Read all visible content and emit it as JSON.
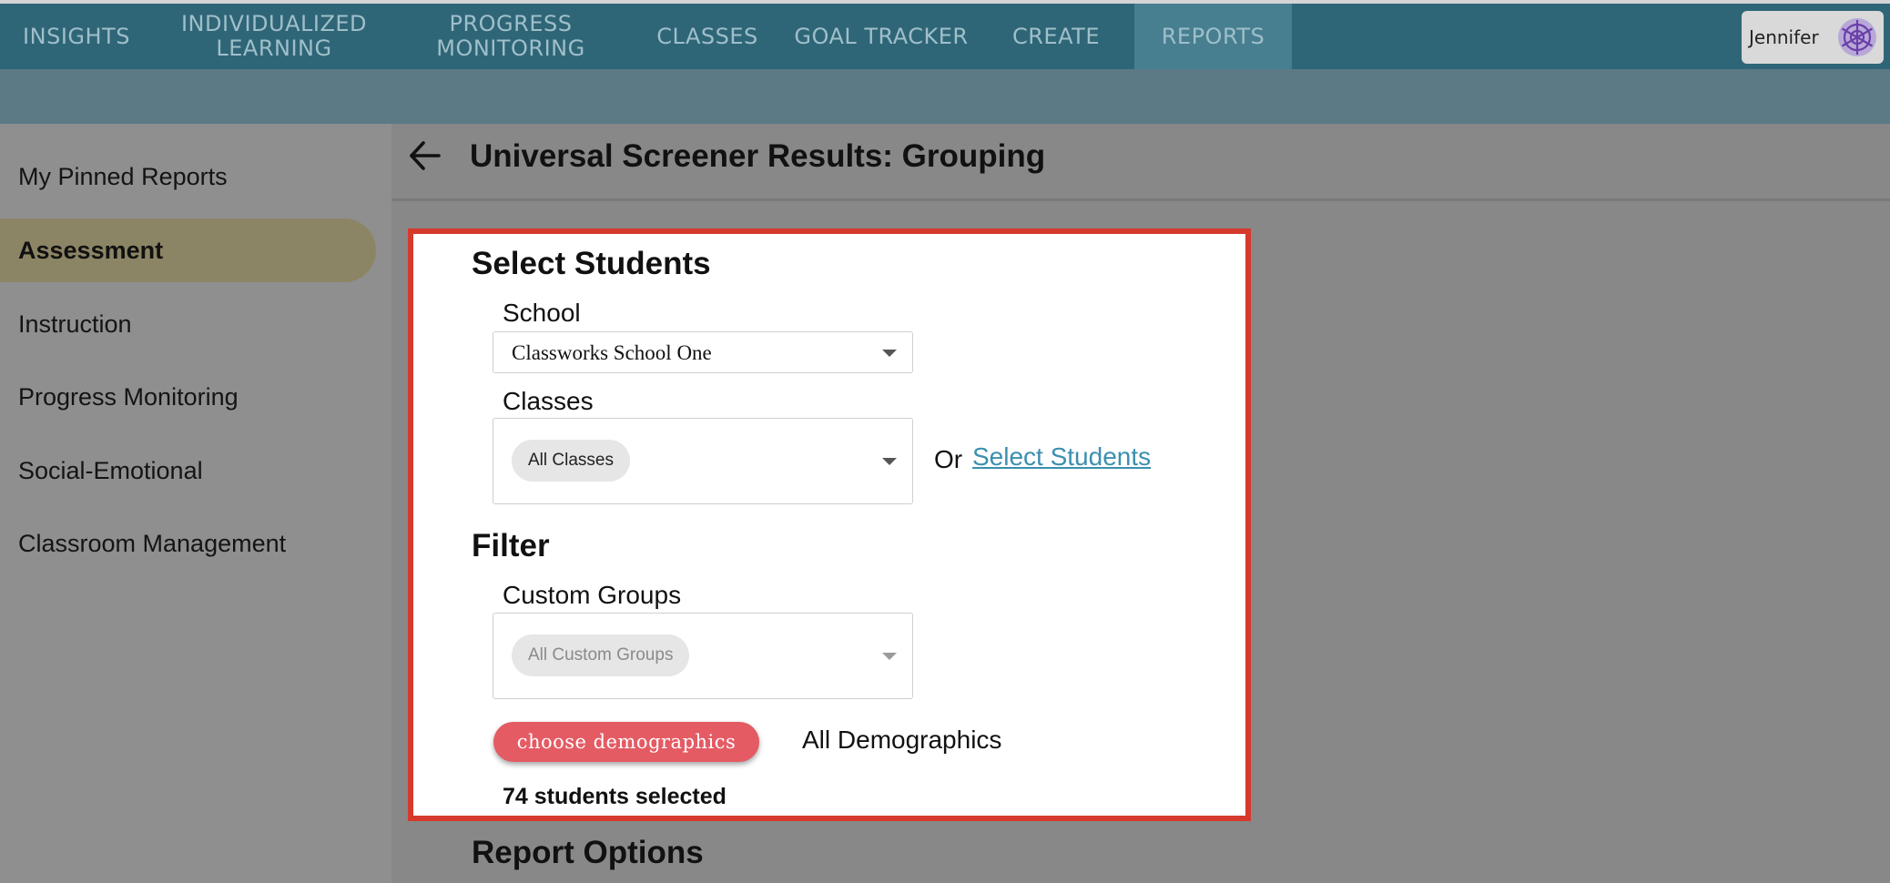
{
  "nav": {
    "items": [
      {
        "label": "INSIGHTS"
      },
      {
        "label": "INDIVIDUALIZED\nLEARNING"
      },
      {
        "label": "PROGRESS\nMONITORING"
      },
      {
        "label": "CLASSES"
      },
      {
        "label": "GOAL TRACKER"
      },
      {
        "label": "CREATE"
      },
      {
        "label": "REPORTS",
        "active": true
      }
    ],
    "user_name": "Jennifer",
    "avatar_icon": "snowflake-avatar-icon"
  },
  "sidebar": {
    "items": [
      {
        "label": "My Pinned Reports"
      },
      {
        "label": "Assessment",
        "active": true
      },
      {
        "label": "Instruction"
      },
      {
        "label": "Progress Monitoring"
      },
      {
        "label": "Social-Emotional"
      },
      {
        "label": "Classroom Management"
      }
    ]
  },
  "header": {
    "title": "Universal Screener Results: Grouping",
    "back_icon": "arrow-left-icon"
  },
  "select_students": {
    "heading": "Select Students",
    "school_label": "School",
    "school_value": "Classworks School One",
    "classes_label": "Classes",
    "classes_chip": "All Classes",
    "or_text": "Or",
    "select_students_link": "Select Students"
  },
  "filter": {
    "heading": "Filter",
    "custom_groups_label": "Custom Groups",
    "custom_groups_chip": "All Custom Groups",
    "demographics_button": "choose demographics",
    "demographics_value": "All Demographics",
    "students_selected": "74 students selected"
  },
  "report_options": {
    "heading": "Report Options"
  },
  "colors": {
    "nav_bg": "#2f6677",
    "nav_active": "#477f90",
    "sidebar_active": "#8c8565",
    "highlight_border": "#d63a2c",
    "button": "#e45b64",
    "link": "#3b8fb0"
  }
}
